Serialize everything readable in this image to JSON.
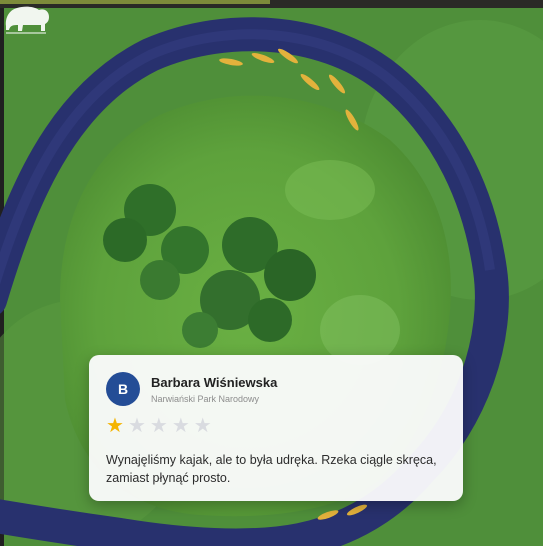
{
  "review": {
    "avatar_initial": "B",
    "reviewer_name": "Barbara Wiśniewska",
    "reviewer_place": "Narwiański Park Narodowy",
    "rating": 1,
    "rating_max": 5,
    "text": "Wynajęliśmy kajak, ale to była udręka. Rzeka ciągle skręca, zamiast płynąć prosto."
  },
  "colors": {
    "star_filled": "#f4b400",
    "star_empty": "#d9dbe0",
    "avatar_bg": "#244d96"
  },
  "icons": {
    "logo": "bison-icon",
    "rating": "star-icon"
  }
}
